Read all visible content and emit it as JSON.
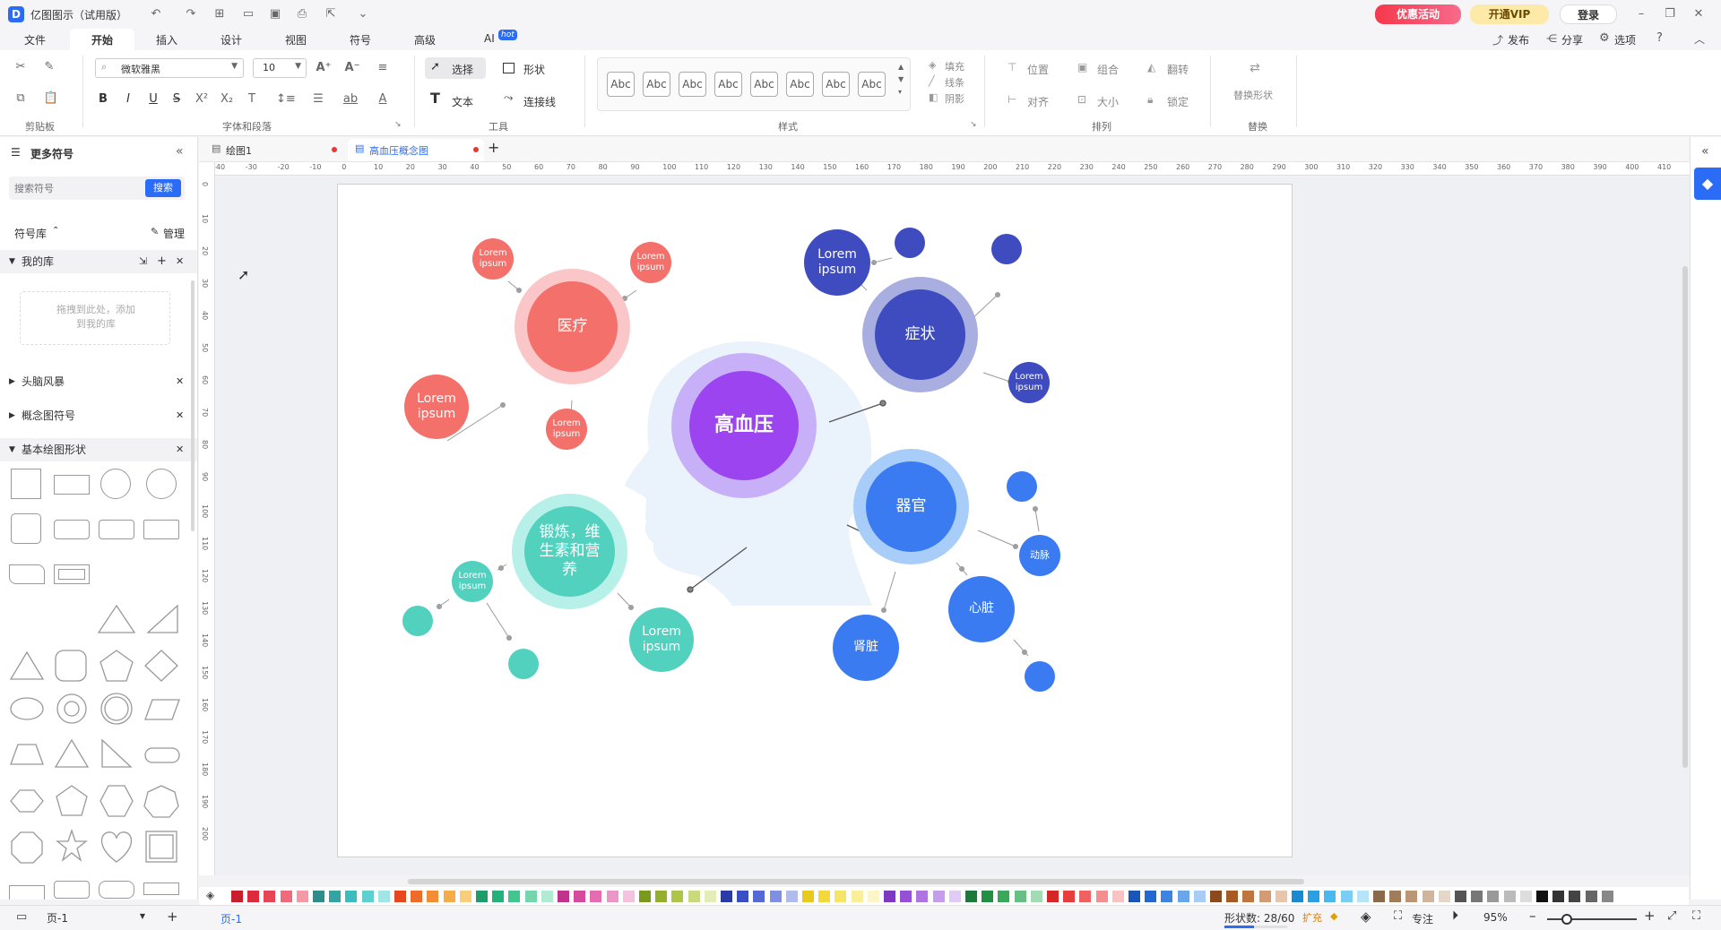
{
  "app": {
    "title": "亿图图示（试用版）",
    "promo": "优惠活动",
    "vip": "开通VIP",
    "login": "登录"
  },
  "menus": [
    "文件",
    "开始",
    "插入",
    "设计",
    "视图",
    "符号",
    "高级",
    "AI"
  ],
  "ai_badge": "hot",
  "right_actions": {
    "publish": "发布",
    "share": "分享",
    "options": "选项"
  },
  "ribbon": {
    "font_name": "微软雅黑",
    "font_size": "10",
    "group_font": "字体和段落",
    "group_clip": "剪贴板",
    "group_tools": "工具",
    "group_style": "样式",
    "group_arrange": "排列",
    "group_replace": "替换",
    "select": "选择",
    "shape": "形状",
    "text": "文本",
    "connector": "连接线",
    "style_labels": [
      "Abc",
      "Abc",
      "Abc",
      "Abc",
      "Abc",
      "Abc",
      "Abc",
      "Abc"
    ],
    "fill": "填充",
    "line": "线条",
    "shadow": "阴影",
    "position": "位置",
    "group": "组合",
    "flip": "翻转",
    "align": "对齐",
    "size": "大小",
    "lock": "锁定",
    "replace_shape": "替换形状"
  },
  "leftpanel": {
    "title": "更多符号",
    "search_placeholder": "搜索符号",
    "search_btn": "搜索",
    "library": "符号库",
    "manage": "管理",
    "my_lib": "我的库",
    "drop_hint": "拖拽到此处，添加到我的库",
    "sections": [
      "头脑风暴",
      "概念图符号",
      "基本绘图形状"
    ]
  },
  "tabs": [
    {
      "label": "绘图1"
    },
    {
      "label": "高血压概念图"
    }
  ],
  "hruler": [
    "-40",
    "-30",
    "-20",
    "-10",
    "0",
    "10",
    "20",
    "30",
    "40",
    "50",
    "60",
    "70",
    "80",
    "90",
    "100",
    "110",
    "120",
    "130",
    "140",
    "150",
    "160",
    "170",
    "180",
    "190",
    "200",
    "210",
    "220",
    "230",
    "240",
    "250",
    "260",
    "270",
    "280",
    "290",
    "300",
    "310",
    "320",
    "330",
    "340",
    "350",
    "360",
    "370",
    "380",
    "390",
    "400",
    "410"
  ],
  "vruler": [
    "0",
    "10",
    "20",
    "30",
    "40",
    "50",
    "60",
    "70",
    "80",
    "90",
    "100",
    "110",
    "120",
    "130",
    "140",
    "150",
    "160",
    "170",
    "180",
    "190",
    "200"
  ],
  "diagram": {
    "center": "高血压",
    "medical": "医疗",
    "symptom": "症状",
    "organ": "器官",
    "exercise": "锻炼，维生素和营养",
    "lorem": "Lorem ipsum",
    "artery": "动脉",
    "heart": "心脏",
    "kidney": "肾脏"
  },
  "colors": {
    "brand": "#2b6cf6",
    "red": "#f4706b",
    "red_ring": "#fbc6c8",
    "purple": "#9b44f0",
    "purple_ring": "#c7b0f8",
    "navy": "#3e4cbf",
    "navy_ring": "#a9aee0",
    "blue": "#3b7bf2",
    "blue_ring": "#a9cdf9",
    "teal": "#52d1bf",
    "teal_ring": "#b6f0e8",
    "head": "#eaf2fb"
  },
  "palette": [
    "#c81e2e",
    "#dc2b3c",
    "#e64555",
    "#ef6a7a",
    "#f49aa6",
    "#2d8c8c",
    "#33a3a3",
    "#3cbcbc",
    "#5ed0d0",
    "#a0e6e6",
    "#e8461f",
    "#f06a2a",
    "#f28c35",
    "#f6ad49",
    "#f9cd7a",
    "#1e9c6a",
    "#25b27a",
    "#44c48f",
    "#75d6ae",
    "#b2ebd3",
    "#c0338a",
    "#d64a9e",
    "#e26db3",
    "#ec95c9",
    "#f4c1df",
    "#7a9a1e",
    "#94b02b",
    "#adc64a",
    "#c8da7e",
    "#e2edb8",
    "#2a3aa6",
    "#3a4fc4",
    "#5469d6",
    "#7f8fe2",
    "#b0bbee",
    "#e8c91e",
    "#f2d83a",
    "#f6e466",
    "#f9ee9a",
    "#fbf5c8",
    "#7d3ac0",
    "#9550d6",
    "#ad74e2",
    "#c69ded",
    "#e0cbf6",
    "#1a7a3a",
    "#228f45",
    "#38a85a",
    "#66c084",
    "#a3dbb5",
    "#d62626",
    "#e83d3d",
    "#f06262",
    "#f58f8f",
    "#f9c3c3",
    "#1a55b8",
    "#2268d0",
    "#3d84e2",
    "#6aa6ec",
    "#a8ccf5",
    "#8a4a1e",
    "#a85a24",
    "#c0743e",
    "#d49a70",
    "#e7c6ab",
    "#1a8ad0",
    "#2aa0e2",
    "#4ab8ee",
    "#7acdf3",
    "#b6e4f9",
    "#8a6a4a",
    "#a07c5a",
    "#b89676",
    "#d0b49e",
    "#e6d6c8",
    "#555555",
    "#777777",
    "#999999",
    "#bbbbbb",
    "#dddddd",
    "#111111",
    "#333333",
    "#444444",
    "#666666",
    "#888888"
  ],
  "status": {
    "page_sel": "页-1",
    "page_tab": "页-1",
    "shape_count_label": "形状数: 28/60",
    "expand": "扩充",
    "focus": "专注",
    "zoom": "95%"
  }
}
